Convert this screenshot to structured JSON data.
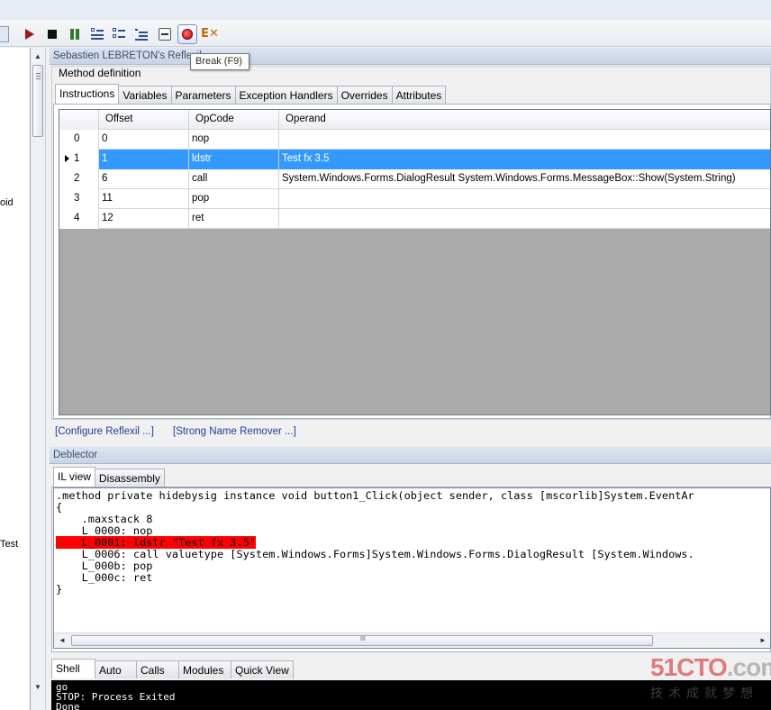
{
  "toolbar": {
    "tooltip": "Break (F9)",
    "buttons": [
      "run-icon",
      "stop-icon",
      "pause-icon",
      "step-into-icon",
      "step-over-icon",
      "step-out-icon",
      "run-to-cursor-icon",
      "break-icon",
      "detach-icon"
    ]
  },
  "left_pane": {
    "text1": "oid",
    "text2": "Test"
  },
  "reflexil": {
    "title": "Sebastien LEBRETON's Reflexil",
    "group_label": "Method definition",
    "tabs": [
      "Instructions",
      "Variables",
      "Parameters",
      "Exception Handlers",
      "Overrides",
      "Attributes"
    ],
    "active_tab": "Instructions",
    "columns": [
      "Offset",
      "OpCode",
      "Operand"
    ],
    "rows": [
      {
        "index": "0",
        "offset": "0",
        "opcode": "nop",
        "operand": ""
      },
      {
        "index": "1",
        "offset": "1",
        "opcode": "ldstr",
        "operand": "Test fx 3.5"
      },
      {
        "index": "2",
        "offset": "6",
        "opcode": "call",
        "operand": "System.Windows.Forms.DialogResult System.Windows.Forms.MessageBox::Show(System.String)"
      },
      {
        "index": "3",
        "offset": "11",
        "opcode": "pop",
        "operand": ""
      },
      {
        "index": "4",
        "offset": "12",
        "opcode": "ret",
        "operand": ""
      }
    ],
    "selected_row": 1,
    "links": {
      "configure": "[Configure Reflexil ...]",
      "strong_name": "[Strong Name Remover ...]"
    }
  },
  "deblector": {
    "title": "Deblector",
    "tabs": [
      "IL view",
      "Disassembly"
    ],
    "active_tab": "IL view",
    "code_lines": [
      ".method private hidebysig instance void button1_Click(object sender, class [mscorlib]System.EventAr",
      "{",
      "    .maxstack 8",
      "    L_0000: nop",
      "    L_0001: ldstr \"Test fx 3.5\"",
      "    L_0006: call valuetype [System.Windows.Forms]System.Windows.Forms.DialogResult [System.Windows.",
      "    L_000b: pop",
      "    L_000c: ret",
      "}"
    ],
    "highlight_line": 4,
    "highlight_color": "#ff0000",
    "scroll_grip": "III"
  },
  "console": {
    "tabs": [
      "Shell",
      "Auto",
      "Calls",
      "Modules",
      "Quick View"
    ],
    "active_tab": "Shell",
    "lines": [
      "go",
      "STOP: Process Exited",
      "Done"
    ]
  },
  "watermark": {
    "logo_a": "51CTO",
    "logo_b": ".com",
    "sub": "技术成就梦想"
  },
  "colors": {
    "selection": "#3399ff",
    "link": "#1f3f9a",
    "grid_empty": "#aaaaaa"
  }
}
